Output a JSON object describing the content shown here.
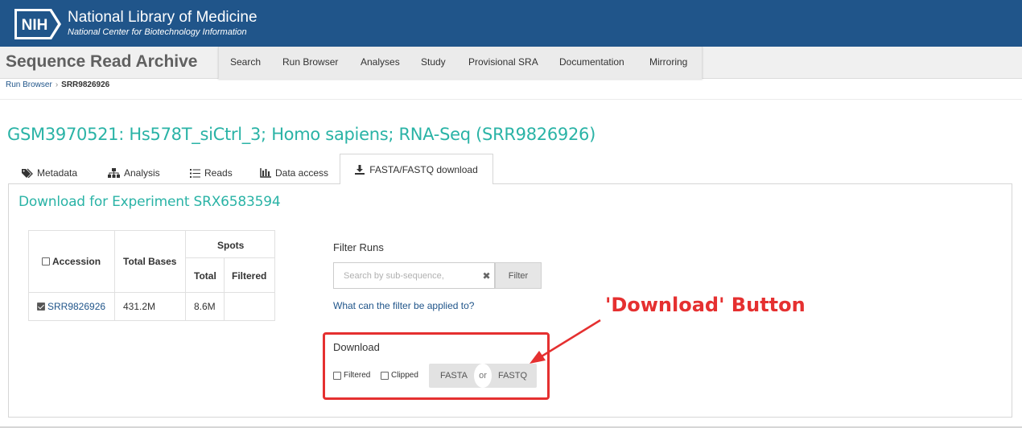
{
  "header": {
    "logo_text": "NIH",
    "title": "National Library of Medicine",
    "subtitle": "National Center for Biotechnology Information",
    "bg_color": "#20558a"
  },
  "app": {
    "title": "Sequence Read Archive",
    "nav": [
      {
        "label": "Search"
      },
      {
        "label": "Run Browser"
      },
      {
        "label": "Analyses"
      },
      {
        "label": "Study"
      },
      {
        "label": "Provisional SRA"
      },
      {
        "label": "Documentation"
      },
      {
        "label": "Mirroring"
      }
    ]
  },
  "breadcrumb": {
    "link": "Run Browser",
    "separator": "›",
    "current": "SRR9826926"
  },
  "page": {
    "title": "GSM3970521: Hs578T_siCtrl_3; Homo sapiens; RNA-Seq (SRR9826926)",
    "accent_color": "#2ab3a6"
  },
  "tabs": [
    {
      "label": "Metadata",
      "icon": "tag-icon"
    },
    {
      "label": "Analysis",
      "icon": "sitemap-icon"
    },
    {
      "label": "Reads",
      "icon": "list-icon"
    },
    {
      "label": "Data access",
      "icon": "data-access-icon"
    },
    {
      "label": "FASTA/FASTQ download",
      "icon": "download-icon",
      "active": true
    }
  ],
  "panel": {
    "title": "Download for Experiment SRX6583594"
  },
  "table": {
    "headers": {
      "accession": "Accession",
      "total_bases": "Total Bases",
      "spots": "Spots",
      "total": "Total",
      "filtered": "Filtered"
    },
    "rows": [
      {
        "accession": "SRR9826926",
        "total_bases": "431.2M",
        "total": "8.6M",
        "filtered": "",
        "checked": true
      }
    ]
  },
  "filter": {
    "label": "Filter Runs",
    "placeholder": "Search by sub-sequence,",
    "clear": "✖",
    "button": "Filter",
    "help_link": "What can the filter be applied to?"
  },
  "download": {
    "label": "Download",
    "opt_filtered": "Filtered",
    "opt_clipped": "Clipped",
    "fasta": "FASTA",
    "or": "or",
    "fastq": "FASTQ"
  },
  "annotation": {
    "text": "'Download' Button",
    "color": "#e53030"
  }
}
